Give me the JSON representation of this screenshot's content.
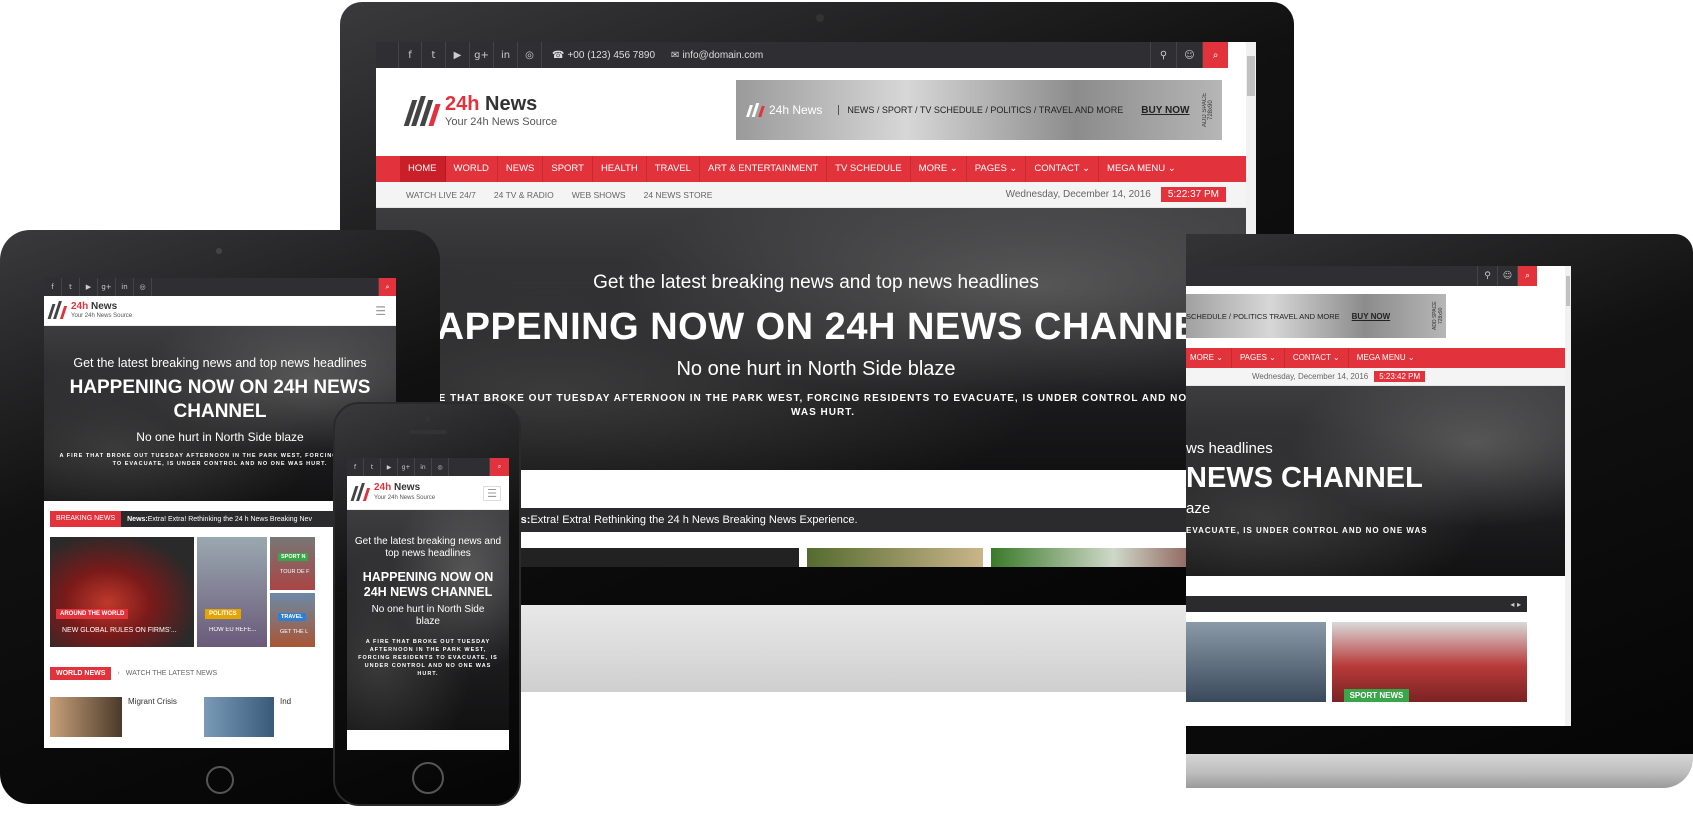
{
  "social_icons": [
    {
      "name": "facebook-icon",
      "glyph": "f"
    },
    {
      "name": "twitter-icon",
      "glyph": "t"
    },
    {
      "name": "youtube-icon",
      "glyph": "▶"
    },
    {
      "name": "google-plus-icon",
      "glyph": "g+"
    },
    {
      "name": "linkedin-icon",
      "glyph": "in"
    },
    {
      "name": "instagram-icon",
      "glyph": "◎"
    }
  ],
  "contact": {
    "phone": "+00 (123) 456 7890",
    "email": "info@domain.com"
  },
  "right_icons": [
    {
      "name": "location-icon",
      "glyph": "⚲"
    },
    {
      "name": "user-icon",
      "glyph": "☺"
    },
    {
      "name": "search-icon",
      "glyph": "⌕"
    }
  ],
  "brand": {
    "num": "24h",
    "name": " News",
    "tagline": "Your 24h News Source"
  },
  "ad": {
    "brand": "24h News",
    "links": "NEWS / SPORT / TV SCHEDULE / POLITICS / TRAVEL AND MORE",
    "buy": "BUY NOW",
    "size": "ADD SPACE 728x90",
    "links_short": "SCHEDULE / POLITICS TRAVEL AND MORE"
  },
  "nav": [
    {
      "label": "HOME"
    },
    {
      "label": "WORLD"
    },
    {
      "label": "NEWS"
    },
    {
      "label": "SPORT"
    },
    {
      "label": "HEALTH"
    },
    {
      "label": "TRAVEL"
    },
    {
      "label": "ART & ENTERTAINMENT"
    },
    {
      "label": "TV SCHEDULE"
    },
    {
      "label": "MORE ⌄"
    },
    {
      "label": "PAGES ⌄"
    },
    {
      "label": "CONTACT ⌄"
    },
    {
      "label": "MEGA MENU ⌄"
    }
  ],
  "subnav": [
    {
      "label": "WATCH LIVE 24/7"
    },
    {
      "label": "24 TV & RADIO"
    },
    {
      "label": "WEB SHOWS"
    },
    {
      "label": "24 NEWS STORE"
    }
  ],
  "date": "Wednesday, December 14, 2016",
  "time_desktop": "5:22:37 PM",
  "time_laptop": "5:23:42 PM",
  "hero": {
    "sub": "Get the latest breaking news and top news headlines",
    "main": "HAPPENING NOW ON 24H NEWS CHANNEL",
    "h3": "No one hurt in North Side blaze",
    "desc": "A FIRE THAT BROKE OUT TUESDAY AFTERNOON IN THE PARK WEST, FORCING RESIDENTS TO EVACUATE, IS UNDER CONTROL AND NO ONE WAS HURT.",
    "desc_cut": "RE THAT BROKE OUT TUESDAY AFTERNOON IN THE PARK WEST, FORCING RESIDENTS TO EVACUATE, IS UNDER CONTROL AND NO ONE WAS HURT.",
    "sub_cut": "ws headlines",
    "main_cut": "NEWS CHANNEL",
    "h3_cut": "aze",
    "desc_laptop": "EVACUATE, IS UNDER CONTROL AND NO ONE WAS"
  },
  "ticker": {
    "label": "BREAKING NEWS",
    "prefix": "News:",
    "text": " Extra! Extra! Rethinking the 24 h News Breaking News Experience.",
    "prefix_cut": "ews:",
    "text_short": " Extra! Extra! Rethinking the 24 h News Breaking Nev",
    "arrows": "◂ ▸"
  },
  "tablet_thumbs": [
    {
      "badge": "AROUND THE WORLD",
      "caption": "NEW GLOBAL RULES ON FIRMS'..."
    },
    {
      "badge": "POLITICS",
      "caption": "HOW EU REFE..."
    },
    {
      "badge": "SPORT N",
      "caption": "TOUR DE F"
    },
    {
      "badge": "TRAVEL",
      "caption": "GET THE L"
    }
  ],
  "world_news": {
    "label": "WORLD NEWS",
    "watch": "WATCH THE LATEST NEWS",
    "item1": "Migrant Crisis",
    "item2": "Ind"
  },
  "laptop_badge": "SPORT NEWS",
  "colors": {
    "accent": "#e2323b",
    "topbar": "#2f2f33"
  }
}
